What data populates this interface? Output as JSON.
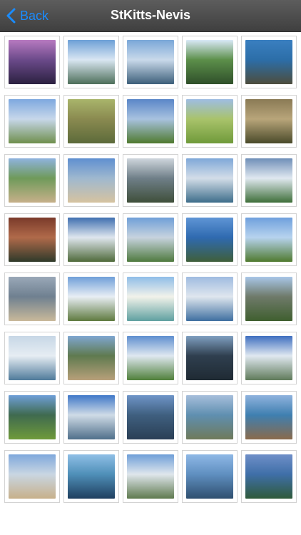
{
  "header": {
    "back_label": "Back",
    "title": "StKitts-Nevis",
    "accent_color": "#1a8cff"
  },
  "gallery": {
    "thumbnails": [
      {
        "icon": "sunset-photo",
        "colors": [
          "#b77ac0",
          "#6b4a8a",
          "#2b2140"
        ]
      },
      {
        "icon": "clouds-bay-photo",
        "colors": [
          "#6da0d6",
          "#d9e6f2",
          "#4e6f5a"
        ]
      },
      {
        "icon": "harbor-photo",
        "colors": [
          "#7aa7d8",
          "#c9d9ea",
          "#3d5f7a"
        ]
      },
      {
        "icon": "tree-hill-photo",
        "colors": [
          "#d9e9f7",
          "#5c8f4a",
          "#2f4f2a"
        ]
      },
      {
        "icon": "rocky-coast-photo",
        "colors": [
          "#3a7fc0",
          "#2c6ea8",
          "#4d4d3c"
        ]
      },
      {
        "icon": "palm-trees-photo",
        "colors": [
          "#7ea8df",
          "#c7d7ea",
          "#6f8f4d"
        ]
      },
      {
        "icon": "dry-field-photo",
        "colors": [
          "#a9b56b",
          "#8a8a50",
          "#5c6a3a"
        ]
      },
      {
        "icon": "palm-field-photo",
        "colors": [
          "#5a86c8",
          "#a8c2df",
          "#4f7a2f"
        ]
      },
      {
        "icon": "golf-green-photo",
        "colors": [
          "#9ebde3",
          "#a9c36b",
          "#6f9a3a"
        ]
      },
      {
        "icon": "monkey-photo",
        "colors": [
          "#8a7a55",
          "#b8a57a",
          "#4a4a2a"
        ]
      },
      {
        "icon": "peninsula-photo",
        "colors": [
          "#8fb3de",
          "#6f9a5a",
          "#c7b08a"
        ]
      },
      {
        "icon": "beach-photo",
        "colors": [
          "#5f8fd0",
          "#9fb8cf",
          "#d6c3a0"
        ]
      },
      {
        "icon": "cloudy-mountain-photo",
        "colors": [
          "#cfd6dd",
          "#6f7f88",
          "#3f4f3a"
        ]
      },
      {
        "icon": "volcano-island-photo",
        "colors": [
          "#7fa8d8",
          "#d3dde8",
          "#3e6d8a"
        ]
      },
      {
        "icon": "cottages-photo",
        "colors": [
          "#6f8fb8",
          "#e0e8f0",
          "#3f6f3a"
        ]
      },
      {
        "icon": "restaurant-photo",
        "colors": [
          "#7a3a2a",
          "#b06a4a",
          "#2f3a2a"
        ]
      },
      {
        "icon": "mountain-tree-photo",
        "colors": [
          "#3f6fb0",
          "#dfe6ee",
          "#4f6a3a"
        ]
      },
      {
        "icon": "airplane-wing-photo",
        "colors": [
          "#6f9fd8",
          "#c7d3de",
          "#4f7a3f"
        ]
      },
      {
        "icon": "ocean-cliffs-photo",
        "colors": [
          "#5f95d5",
          "#2f6ab0",
          "#3f5f3a"
        ]
      },
      {
        "icon": "sugar-mill-photo",
        "colors": [
          "#6fa0dd",
          "#b7d3ee",
          "#4f7a2f"
        ]
      },
      {
        "icon": "grey-beach-photo",
        "colors": [
          "#9aa8b8",
          "#6f8090",
          "#c9b99a"
        ]
      },
      {
        "icon": "plantation-house-photo",
        "colors": [
          "#6f9fd8",
          "#e8eef4",
          "#5f7a3f"
        ]
      },
      {
        "icon": "teal-house-photo",
        "colors": [
          "#8fbde8",
          "#f2f2ea",
          "#5fa0a0"
        ]
      },
      {
        "icon": "ocean-view-photo",
        "colors": [
          "#9fbbe0",
          "#dfe6ee",
          "#3f6fa0"
        ]
      },
      {
        "icon": "ruins-palm-photo",
        "colors": [
          "#a8c6e8",
          "#6f7a6a",
          "#3f5f2f"
        ]
      },
      {
        "icon": "hazy-sea-photo",
        "colors": [
          "#c7d7e6",
          "#e6edf3",
          "#4f7a9a"
        ]
      },
      {
        "icon": "railway-photo",
        "colors": [
          "#7fa6d0",
          "#5f7a4f",
          "#b8a07a"
        ]
      },
      {
        "icon": "cloud-fields-photo",
        "colors": [
          "#5f8fcf",
          "#dfe8f0",
          "#4f7f3a"
        ]
      },
      {
        "icon": "dark-terrace-photo",
        "colors": [
          "#7f9fc0",
          "#2f3f4f",
          "#1f2a33"
        ]
      },
      {
        "icon": "town-clouds-photo",
        "colors": [
          "#3f6fc0",
          "#e0e8f0",
          "#5f7a5a"
        ]
      },
      {
        "icon": "beach-mountain-photo",
        "colors": [
          "#6f9fd8",
          "#3f6a4f",
          "#6f9a3a"
        ]
      },
      {
        "icon": "sailing-mast-photo",
        "colors": [
          "#3f78c8",
          "#cfdbe6",
          "#4f6f8a"
        ]
      },
      {
        "icon": "nevis-peak-photo",
        "colors": [
          "#6f95c8",
          "#3f5f7f",
          "#2a3f55"
        ]
      },
      {
        "icon": "island-chain-photo",
        "colors": [
          "#a7bfdc",
          "#5f8fb0",
          "#6f7a5a"
        ]
      },
      {
        "icon": "coast-hills-photo",
        "colors": [
          "#8fb3de",
          "#3f7fb0",
          "#8a6a4a"
        ]
      },
      {
        "icon": "sandy-bay-photo",
        "colors": [
          "#7fa8dc",
          "#c9d6e2",
          "#c7b08a"
        ]
      },
      {
        "icon": "silhouette-photo",
        "colors": [
          "#8fbfe6",
          "#4f8fb8",
          "#1f3f5f"
        ]
      },
      {
        "icon": "village-view-photo",
        "colors": [
          "#6f9fd8",
          "#dfe6ec",
          "#5f7a4f"
        ]
      },
      {
        "icon": "tall-ship-photo",
        "colors": [
          "#8fb8e6",
          "#5f8fc0",
          "#2f4f6f"
        ]
      },
      {
        "icon": "agave-sea-photo",
        "colors": [
          "#6f8fc8",
          "#3f6fa8",
          "#2f5a3a"
        ]
      }
    ]
  }
}
